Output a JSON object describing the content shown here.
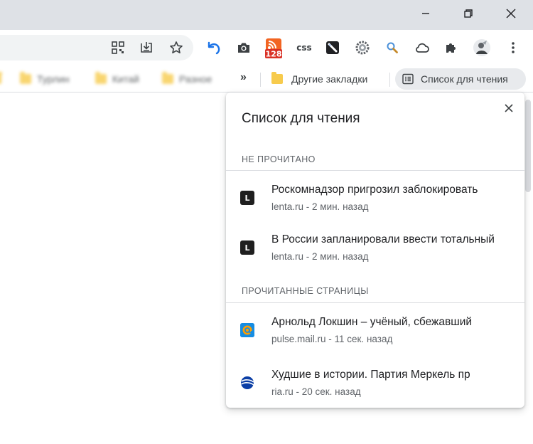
{
  "bookmarks": {
    "blurred": [
      {
        "label": "Турлин"
      },
      {
        "label": "Китай"
      },
      {
        "label": "Разное"
      }
    ],
    "overflow_label": "»",
    "other_label": "Другие закладки",
    "reading_list_label": "Список для чтения"
  },
  "toolbar": {
    "rss_badge": "128",
    "css_label": "css"
  },
  "panel": {
    "title": "Список для чтения",
    "sections": [
      {
        "heading": "НЕ ПРОЧИТАНО",
        "items": [
          {
            "title": "Роскомнадзор пригрозил заблокировать",
            "source": "lenta.ru - 2 мин. назад",
            "favicon": "lenta",
            "favicon_letter": "L"
          },
          {
            "title": "В России запланировали ввести тотальный",
            "source": "lenta.ru - 2 мин. назад",
            "favicon": "lenta",
            "favicon_letter": "L"
          }
        ]
      },
      {
        "heading": "ПРОЧИТАННЫЕ СТРАНИЦЫ",
        "items": [
          {
            "title": "Арнольд Локшин – учёный, сбежавший",
            "source": "pulse.mail.ru - 11 сек. назад",
            "favicon": "mail"
          },
          {
            "title": "Худшие в истории. Партия Меркель пр",
            "source": "ria.ru - 20 сек. назад",
            "favicon": "ria"
          }
        ]
      }
    ]
  },
  "colors": {
    "titlebar": "#dee1e6",
    "accent_undo": "#1a73e8",
    "rss": "#f26522",
    "badge": "#d93025"
  }
}
